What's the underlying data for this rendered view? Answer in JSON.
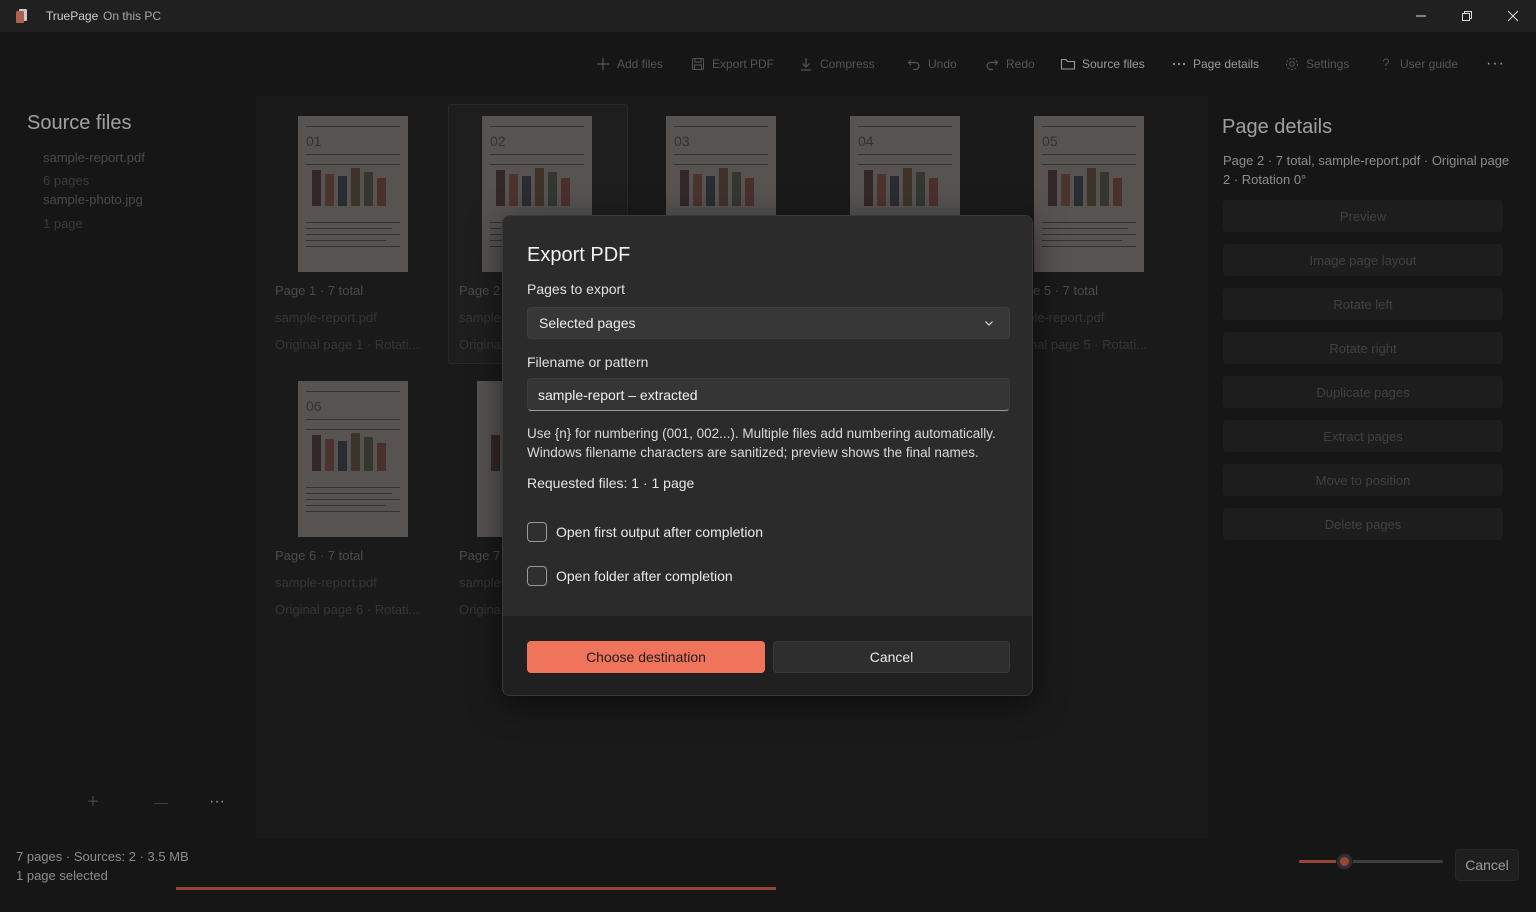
{
  "app": {
    "title": "TruePage",
    "subtitle": "On this PC"
  },
  "window_controls": {
    "minimize": "—",
    "maximize": "□",
    "close": "✕"
  },
  "toolbar": {
    "add_files": "Add files",
    "export_pdf": "Export PDF",
    "compress": "Compress",
    "undo": "Undo",
    "redo": "Redo",
    "source_files": "Source files",
    "page_details": "Page details",
    "settings": "Settings",
    "user_guide": "User guide",
    "more": "···"
  },
  "left_pane": {
    "title": "Source files",
    "sources": [
      {
        "name": "sample-report.pdf",
        "pages": "6 pages"
      },
      {
        "name": "sample-photo.jpg",
        "pages": "1 page"
      }
    ],
    "add": "+",
    "remove": "—",
    "more": "···"
  },
  "pages": [
    {
      "num": "01",
      "caption": "Page 1 · 7 total",
      "file": "sample-report.pdf",
      "orig": "Original page 1 · Rotati..."
    },
    {
      "num": "02",
      "caption": "Page 2",
      "file": "sample",
      "orig": "Origina"
    },
    {
      "num": "03"
    },
    {
      "num": "04"
    },
    {
      "num": "05",
      "caption": "e 5 · 7 total",
      "file": "ple-report.pdf",
      "orig": "inal page 5 · Rotati..."
    },
    {
      "num": "06",
      "caption": "Page 6 · 7 total",
      "file": "sample-report.pdf",
      "orig": "Original page 6 · Rotati..."
    },
    {
      "num": "",
      "caption": "Page 7",
      "file": "sample",
      "orig": "Origina"
    }
  ],
  "right_pane": {
    "title": "Page details",
    "info": "Page 2 · 7 total, sample-report.pdf · Original page 2 · Rotation 0°",
    "buttons": [
      "Preview",
      "Image page layout",
      "Rotate left",
      "Rotate right",
      "Duplicate pages",
      "Extract pages",
      "Move to position",
      "Delete pages"
    ]
  },
  "status": {
    "summary": "7 pages · Sources: 2 · 3.5 MB",
    "selection": "1 page selected",
    "progress": 1.0,
    "zoom_level": 0.31,
    "cancel": "Cancel"
  },
  "dialog": {
    "title": "Export PDF",
    "pages_label": "Pages to export",
    "pages_value": "Selected pages",
    "filename_label": "Filename or pattern",
    "filename_value": "sample-report – extracted",
    "help": "Use {n} for numbering (001, 002...). Multiple files add numbering automatically. Windows filename characters are sanitized; preview shows the final names.",
    "requested": "Requested files: 1 · 1 page",
    "open_first": "Open first output after completion",
    "open_folder": "Open folder after completion",
    "primary": "Choose destination",
    "cancel": "Cancel"
  },
  "colors": {
    "accent": "#f0735c",
    "background": "#202020"
  }
}
